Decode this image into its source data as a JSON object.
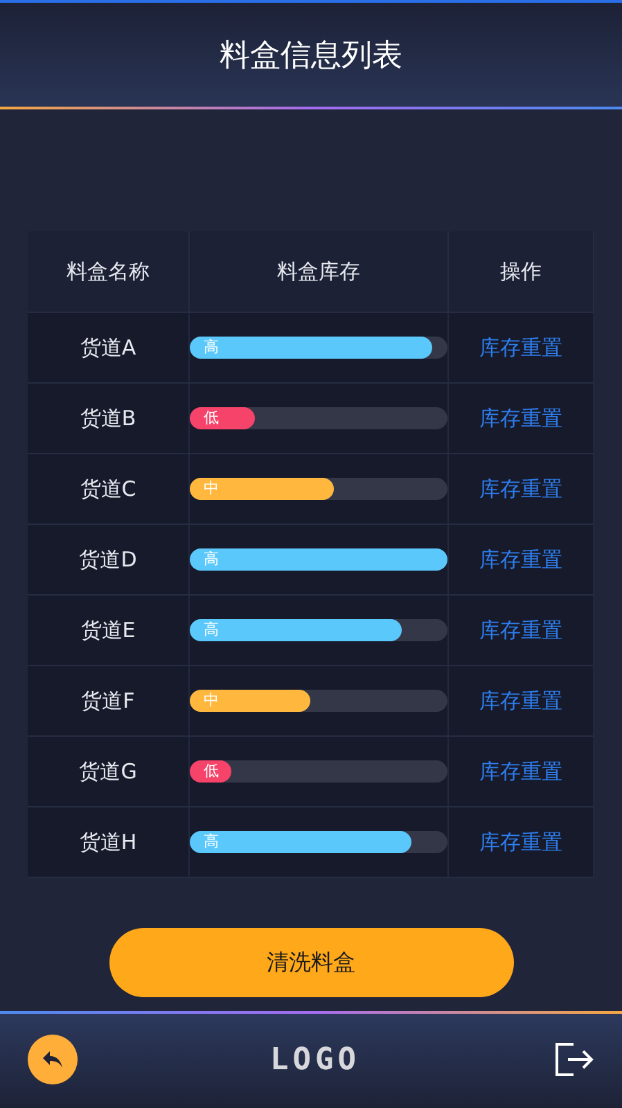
{
  "header": {
    "title": "料盒信息列表"
  },
  "table": {
    "columns": [
      "料盒名称",
      "料盒库存",
      "操作"
    ],
    "rows": [
      {
        "name": "货道A",
        "stock_label": "高",
        "level": 0.94,
        "color": "#5ac8fa",
        "action": "库存重置"
      },
      {
        "name": "货道B",
        "stock_label": "低",
        "level": 0.25,
        "color": "#f5436a",
        "action": "库存重置"
      },
      {
        "name": "货道C",
        "stock_label": "中",
        "level": 0.56,
        "color": "#ffb83d",
        "action": "库存重置"
      },
      {
        "name": "货道D",
        "stock_label": "高",
        "level": 1,
        "color": "#5ac8fa",
        "action": "库存重置"
      },
      {
        "name": "货道E",
        "stock_label": "高",
        "level": 0.82,
        "color": "#5ac8fa",
        "action": "库存重置"
      },
      {
        "name": "货道F",
        "stock_label": "中",
        "level": 0.47,
        "color": "#ffb83d",
        "action": "库存重置"
      },
      {
        "name": "货道G",
        "stock_label": "低",
        "level": 0.16,
        "color": "#f5436a",
        "action": "库存重置"
      },
      {
        "name": "货道H",
        "stock_label": "高",
        "level": 0.86,
        "color": "#5ac8fa",
        "action": "库存重置"
      }
    ]
  },
  "main_button": "清洗料盒",
  "footer": {
    "logo": "LOGO"
  }
}
